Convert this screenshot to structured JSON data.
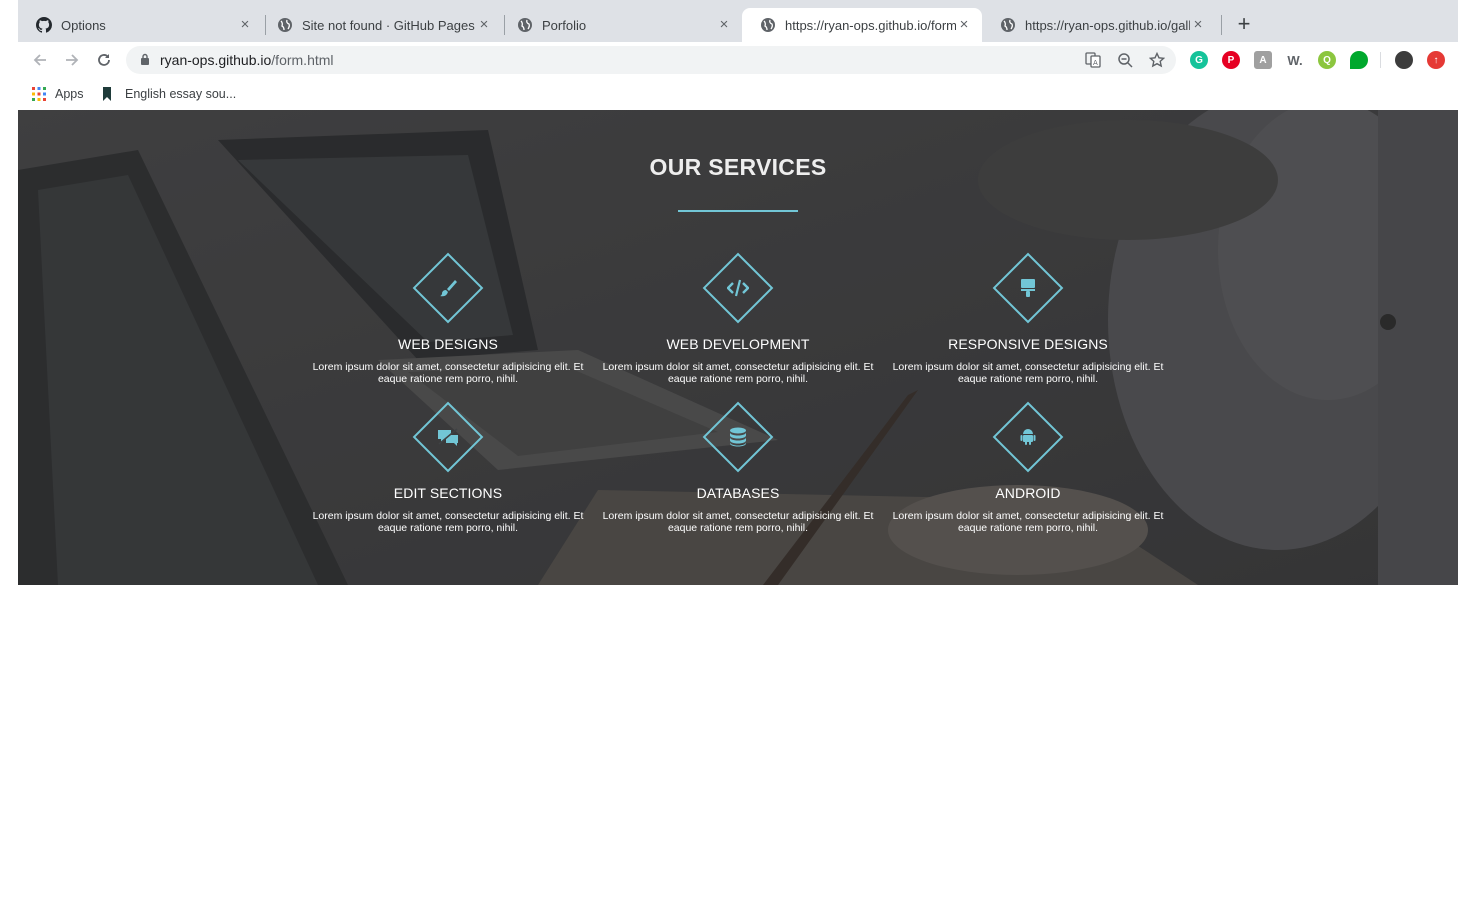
{
  "browser": {
    "tabs": [
      {
        "title": "Options",
        "favicon": "github-icon",
        "active": false
      },
      {
        "title": "Site not found · GitHub Pages",
        "favicon": "globe-icon",
        "active": false
      },
      {
        "title": "Porfolio",
        "favicon": "globe-icon",
        "active": false
      },
      {
        "title": "https://ryan-ops.github.io/form.html",
        "favicon": "globe-icon",
        "active": true
      },
      {
        "title": "https://ryan-ops.github.io/gallery",
        "favicon": "globe-icon",
        "active": false
      }
    ],
    "new_tab_label": "+",
    "close_glyph": "×",
    "address": {
      "host": "ryan-ops.github.io",
      "path": "/form.html"
    },
    "bookmarks": [
      {
        "label": "Apps",
        "icon": "apps-grid-icon"
      },
      {
        "label": "English essay sou...",
        "icon": "bookmark-icon"
      }
    ],
    "extensions": [
      {
        "name": "grammarly-icon",
        "color": "#15c39a",
        "glyph": "G"
      },
      {
        "name": "pinterest-icon",
        "color": "#e60023",
        "glyph": "P"
      },
      {
        "name": "extension-icon",
        "color": "#a0a0a0",
        "glyph": "A"
      },
      {
        "name": "wordtune-icon",
        "color": "#5f6368",
        "glyph": "W."
      },
      {
        "name": "quicktext-icon",
        "color": "#8cc63f",
        "glyph": "Q"
      },
      {
        "name": "evernote-icon",
        "color": "#00a82d",
        "glyph": ""
      },
      {
        "name": "profile-avatar-icon",
        "color": "#3c3c3c",
        "glyph": ""
      },
      {
        "name": "update-icon",
        "color": "#e53935",
        "glyph": "↑"
      }
    ]
  },
  "page": {
    "section_title": "OUR SERVICES",
    "accent_color": "#72c6d6",
    "services": [
      {
        "title": "WEB DESIGNS",
        "icon": "paint-brush-icon",
        "desc_line1": "Lorem ipsum dolor sit amet, consectetur adipisicing elit. Et",
        "desc_line2": "eaque ratione rem porro, nihil."
      },
      {
        "title": "WEB DEVELOPMENT",
        "icon": "code-icon",
        "desc_line1": "Lorem ipsum dolor sit amet, consectetur adipisicing elit. Et",
        "desc_line2": "eaque ratione rem porro, nihil."
      },
      {
        "title": "RESPONSIVE DESIGNS",
        "icon": "paint-roller-icon",
        "desc_line1": "Lorem ipsum dolor sit amet, consectetur adipisicing elit. Et",
        "desc_line2": "eaque ratione rem porro, nihil."
      },
      {
        "title": "EDIT SECTIONS",
        "icon": "edit-sections-icon",
        "desc_line1": "Lorem ipsum dolor sit amet, consectetur adipisicing elit. Et",
        "desc_line2": "eaque ratione rem porro, nihil."
      },
      {
        "title": "DATABASES",
        "icon": "database-icon",
        "desc_line1": "Lorem ipsum dolor sit amet, consectetur adipisicing elit. Et",
        "desc_line2": "eaque ratione rem porro, nihil."
      },
      {
        "title": "ANDROID",
        "icon": "android-icon",
        "desc_line1": "Lorem ipsum dolor sit amet, consectetur adipisicing elit. Et",
        "desc_line2": "eaque ratione rem porro, nihil."
      }
    ]
  }
}
